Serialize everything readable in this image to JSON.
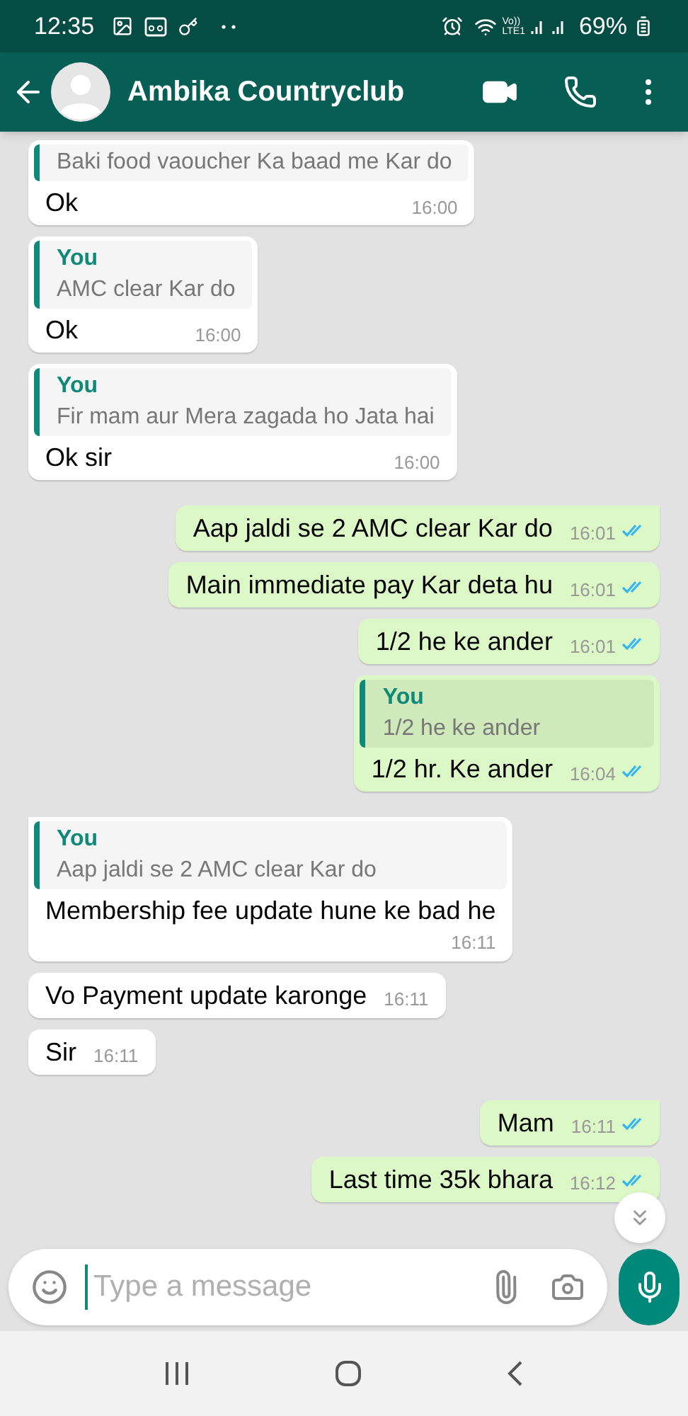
{
  "status_bar": {
    "time": "12:35",
    "network": "Vo))\nLTE1",
    "battery": "69%"
  },
  "header": {
    "title": "Ambika Countryclub"
  },
  "messages": [
    {
      "kind": "incoming",
      "tail": false,
      "quote": {
        "text": "Baki food vaoucher Ka baad me Kar do"
      },
      "text": "Ok",
      "time": "16:00",
      "time_below": false
    },
    {
      "kind": "incoming",
      "tail": false,
      "quote": {
        "author": "You",
        "text": "AMC clear Kar do"
      },
      "text": "Ok",
      "time": "16:00",
      "time_below": false
    },
    {
      "kind": "incoming",
      "tail": false,
      "quote": {
        "author": "You",
        "text": "Fir mam aur Mera zagada ho Jata hai"
      },
      "text": "Ok sir",
      "time": "16:00",
      "time_below": false
    },
    {
      "kind": "outgoing",
      "tail": true,
      "text": "Aap jaldi se 2  AMC clear Kar do",
      "time": "16:01",
      "read": true,
      "time_below": false
    },
    {
      "kind": "outgoing",
      "tail": false,
      "text": "Main immediate pay Kar deta hu",
      "time": "16:01",
      "read": true,
      "time_below": false
    },
    {
      "kind": "outgoing",
      "tail": false,
      "text": "1/2 he ke ander",
      "time": "16:01",
      "read": true,
      "time_below": false
    },
    {
      "kind": "outgoing",
      "tail": false,
      "quote": {
        "author": "You",
        "text": "1/2 he ke ander"
      },
      "text": "1/2 hr. Ke ander",
      "time": "16:04",
      "read": true,
      "time_below": false
    },
    {
      "kind": "incoming",
      "tail": true,
      "quote": {
        "author": "You",
        "text": "Aap jaldi se 2  AMC clear Kar do"
      },
      "text": "Membership fee update hune ke bad he",
      "time": "16:11",
      "time_below": true
    },
    {
      "kind": "incoming",
      "tail": false,
      "text": "Vo Payment update karonge",
      "time": "16:11",
      "time_below": false
    },
    {
      "kind": "incoming",
      "tail": false,
      "text": "Sir",
      "time": "16:11",
      "time_below": false
    },
    {
      "kind": "outgoing",
      "tail": true,
      "text": "Mam",
      "time": "16:11",
      "read": true,
      "time_below": false
    },
    {
      "kind": "outgoing",
      "tail": false,
      "text": "Last time 35k bhara",
      "time": "16:12",
      "read": true,
      "time_below": false
    }
  ],
  "composer": {
    "placeholder": "Type a message"
  }
}
